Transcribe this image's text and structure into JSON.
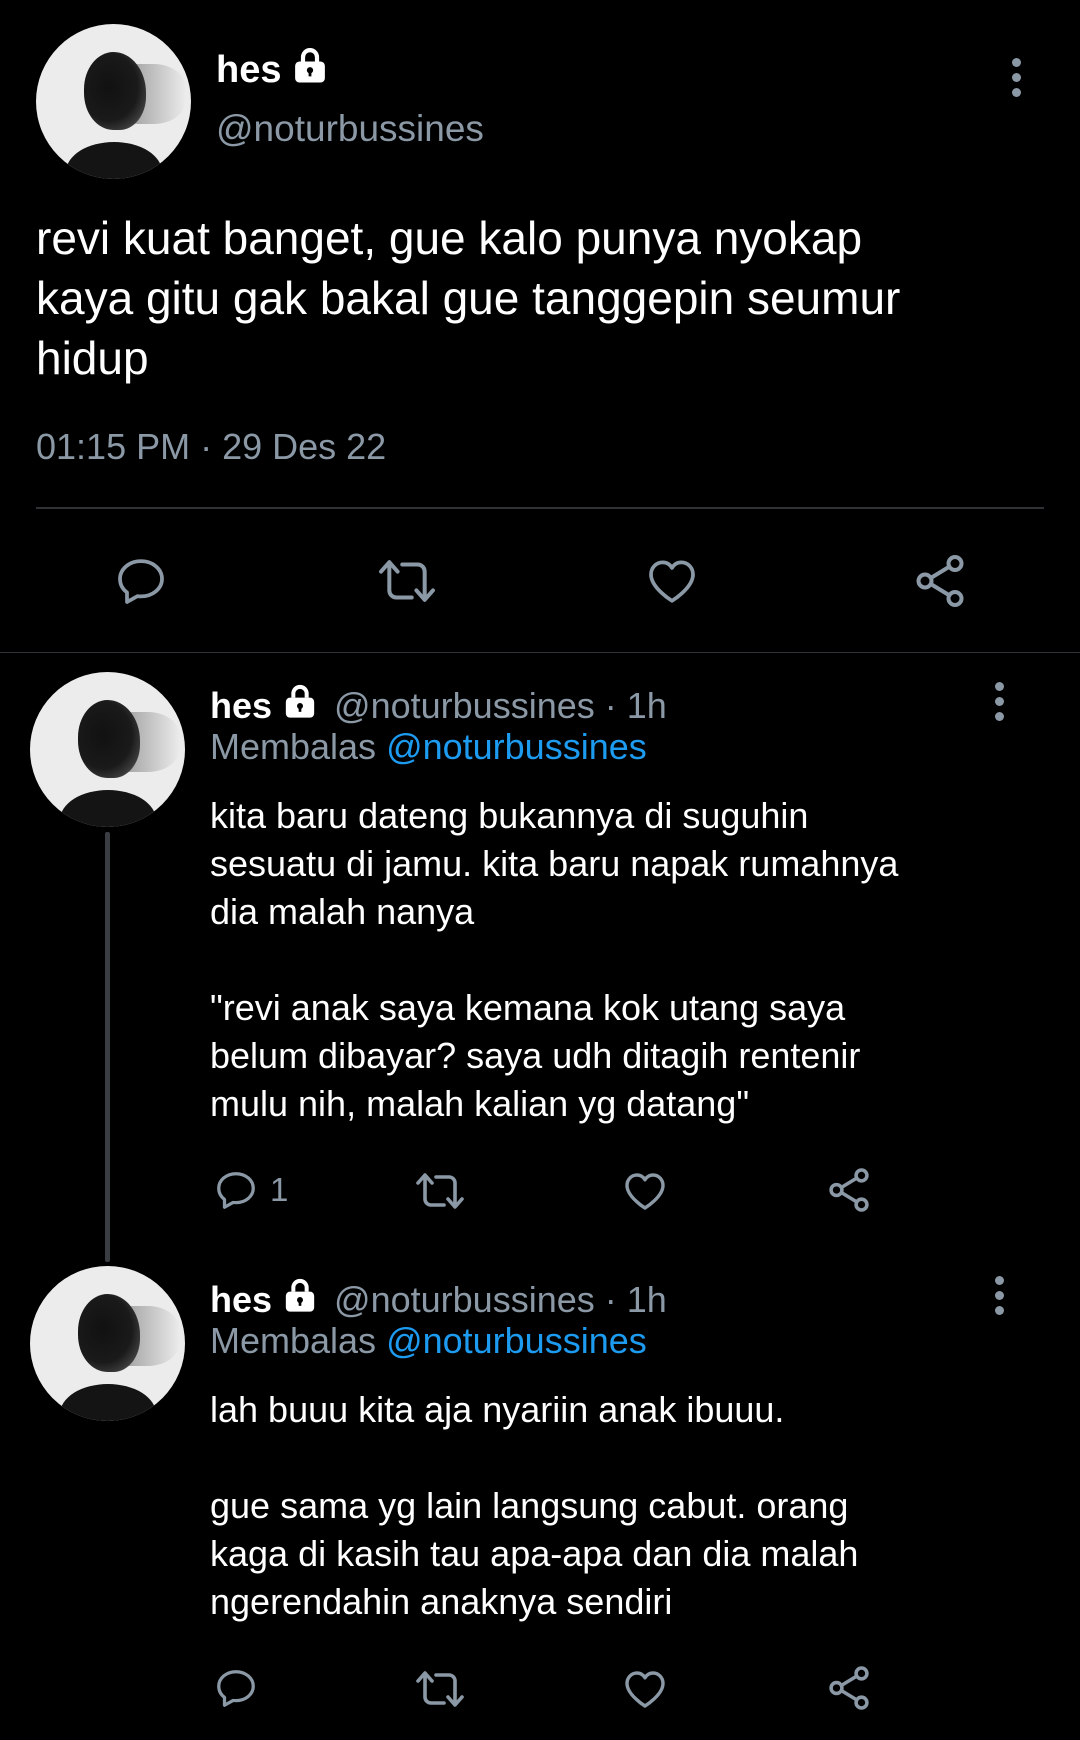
{
  "main_tweet": {
    "display_name": "hes",
    "handle": "@noturbussines",
    "text": "revi kuat banget, gue kalo punya nyokap\nkaya gitu gak bakal gue tanggepin seumur\nhidup",
    "timestamp": "01:15 PM · 29 Des 22"
  },
  "replies": [
    {
      "display_name": "hes",
      "handle": "@noturbussines · 1h",
      "reply_prefix": "Membalas ",
      "reply_mention": "@noturbussines",
      "text": "kita baru dateng bukannya di suguhin\nsesuatu di jamu. kita baru napak rumahnya\ndia malah nanya\n\n\"revi anak saya kemana kok utang saya\nbelum dibayar? saya udh ditagih rentenir\nmulu nih, malah kalian yg datang\"",
      "reply_count": "1"
    },
    {
      "display_name": "hes",
      "handle": "@noturbussines · 1h",
      "reply_prefix": "Membalas ",
      "reply_mention": "@noturbussines",
      "text": "lah buuu kita aja nyariin anak ibuuu.\n\ngue sama yg lain langsung cabut. orang\nkaga di kasih tau apa-apa dan dia malah\nngerendahin anaknya sendiri",
      "reply_count": ""
    }
  ],
  "icons": {
    "lock": "lock-icon",
    "more": "more-vertical-icon",
    "reply": "reply-icon",
    "retweet": "retweet-icon",
    "like": "heart-icon",
    "share": "share-icon"
  },
  "colors": {
    "background": "#000000",
    "text": "#ffffff",
    "secondary": "#8b98a5",
    "mention": "#1d9bf0",
    "divider": "#2f3336"
  }
}
